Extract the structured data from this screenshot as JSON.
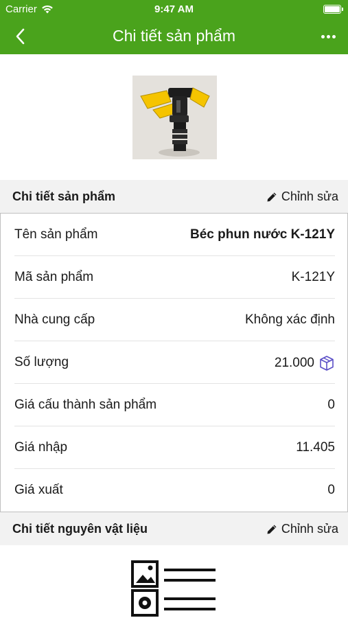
{
  "status_bar": {
    "carrier": "Carrier",
    "time": "9:47 AM",
    "battery_level": 1.0
  },
  "nav": {
    "title": "Chi tiết sản phẩm",
    "back_icon": "chevron-left-icon",
    "more_icon": "more-horizontal-icon"
  },
  "product_section": {
    "label": "Chi tiết sản phẩm",
    "edit_label": "Chỉnh sửa"
  },
  "fields": [
    {
      "label": "Tên sản phẩm",
      "value": "Béc phun nước K-121Y"
    },
    {
      "label": "Mã sản phẩm",
      "value": "K-121Y"
    },
    {
      "label": "Nhà cung cấp",
      "value": "Không xác định"
    },
    {
      "label": "Số lượng",
      "value": "21.000",
      "icon": "box-icon"
    },
    {
      "label": "Giá cấu thành sản phẩm",
      "value": "0"
    },
    {
      "label": "Giá nhập",
      "value": "11.405"
    },
    {
      "label": "Giá xuất",
      "value": "0"
    }
  ],
  "materials_section": {
    "label": "Chi tiết nguyên vật liệu",
    "edit_label": "Chỉnh sửa"
  },
  "colors": {
    "brand_green": "#4aa31c",
    "box_icon": "#5b4fc7"
  }
}
